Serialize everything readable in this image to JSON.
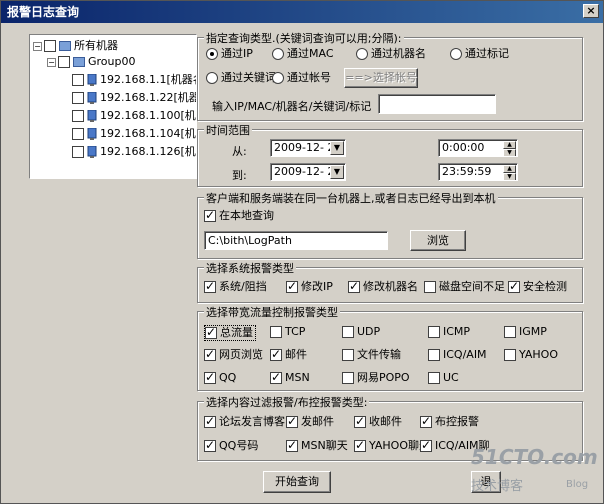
{
  "window": {
    "title": "报警日志查询",
    "close_label": "×"
  },
  "tree": {
    "root": "所有机器",
    "group": "Group00",
    "items": [
      "192.168.1.1[机器名",
      "192.168.1.22[机器名",
      "192.168.1.100[机器名",
      "192.168.1.104[机器名",
      "192.168.1.126[机器名"
    ]
  },
  "query_type": {
    "title": "指定查询类型.(关键词查询可以用;分隔):",
    "options": [
      "通过IP",
      "通过MAC",
      "通过机器名",
      "通过标记",
      "通过关键词",
      "通过帐号"
    ],
    "selected": "通过IP",
    "select_account_button": "==>选择帐号",
    "input_label": "输入IP/MAC/机器名/关键词/标记",
    "input_value": ""
  },
  "time_range": {
    "title": "时间范围",
    "from_label": "从:",
    "to_label": "到:",
    "from_date": "2009-12- 2",
    "to_date": "2009-12- 2",
    "from_time": "0:00:00",
    "to_time": "23:59:59"
  },
  "local": {
    "title": "客户端和服务端装在同一台机器上,或者日志已经导出到本机",
    "checkbox_label": "在本地查询",
    "checked": true,
    "path": "C:\\bith\\LogPath",
    "browse_button": "浏览"
  },
  "sys_alarm": {
    "title": "选择系统报警类型",
    "items": [
      {
        "label": "系统/阻挡",
        "checked": true
      },
      {
        "label": "修改IP",
        "checked": true
      },
      {
        "label": "修改机器名",
        "checked": true
      },
      {
        "label": "磁盘空间不足",
        "checked": false
      },
      {
        "label": "安全检测",
        "checked": true
      }
    ]
  },
  "bandwidth_alarm": {
    "title": "选择带宽流量控制报警类型",
    "items": [
      {
        "label": "总流量",
        "checked": true
      },
      {
        "label": "TCP",
        "checked": false
      },
      {
        "label": "UDP",
        "checked": false
      },
      {
        "label": "ICMP",
        "checked": false
      },
      {
        "label": "IGMP",
        "checked": false
      },
      {
        "label": "网页浏览",
        "checked": true
      },
      {
        "label": "邮件",
        "checked": true
      },
      {
        "label": "文件传输",
        "checked": false
      },
      {
        "label": "ICQ/AIM",
        "checked": false
      },
      {
        "label": "YAHOO",
        "checked": false
      },
      {
        "label": "QQ",
        "checked": true
      },
      {
        "label": "MSN",
        "checked": true
      },
      {
        "label": "网易POPO",
        "checked": false
      },
      {
        "label": "UC",
        "checked": false
      }
    ]
  },
  "content_alarm": {
    "title": "选择内容过滤报警/布控报警类型:",
    "items": [
      {
        "label": "论坛发言博客",
        "checked": true
      },
      {
        "label": "发邮件",
        "checked": true
      },
      {
        "label": "收邮件",
        "checked": true
      },
      {
        "label": "布控报警",
        "checked": true
      },
      {
        "label": "QQ号码",
        "checked": true
      },
      {
        "label": "MSN聊天",
        "checked": true
      },
      {
        "label": "YAHOO聊天",
        "checked": true
      },
      {
        "label": "ICQ/AIM聊",
        "checked": true
      }
    ]
  },
  "buttons": {
    "start_query": "开始查询",
    "exit": "退"
  },
  "watermark": {
    "site": "51CTO.com",
    "sub": "技术博客",
    "blog": "Blog"
  },
  "colors": {
    "titlebar": "#0a246a",
    "dialog_bg": "#d4d0c8"
  }
}
